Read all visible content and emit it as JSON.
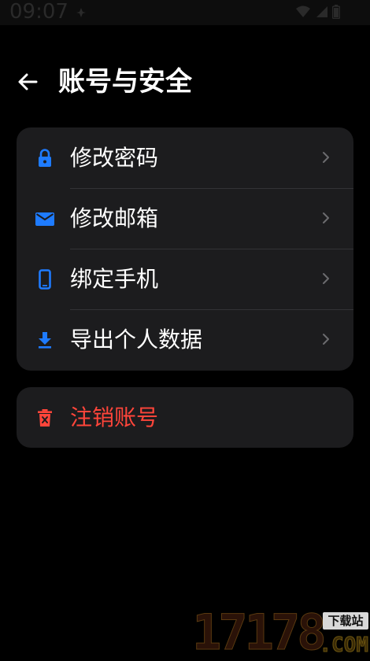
{
  "status_bar": {
    "time": "09:07"
  },
  "header": {
    "title": "账号与安全"
  },
  "menu": {
    "items": [
      {
        "label": "修改密码",
        "icon": "lock-icon"
      },
      {
        "label": "修改邮箱",
        "icon": "mail-icon"
      },
      {
        "label": "绑定手机",
        "icon": "phone-icon"
      },
      {
        "label": "导出个人数据",
        "icon": "download-icon"
      }
    ]
  },
  "danger": {
    "label": "注销账号",
    "icon": "trash-icon"
  },
  "watermark": {
    "digits": "17178",
    "badge": "下载站",
    "domain": ".COM"
  },
  "colors": {
    "background": "#000000",
    "card": "#1c1c1e",
    "accent": "#1e7bff",
    "danger": "#ff453a",
    "text": "#ffffff",
    "chevron": "#6b6b6e"
  }
}
